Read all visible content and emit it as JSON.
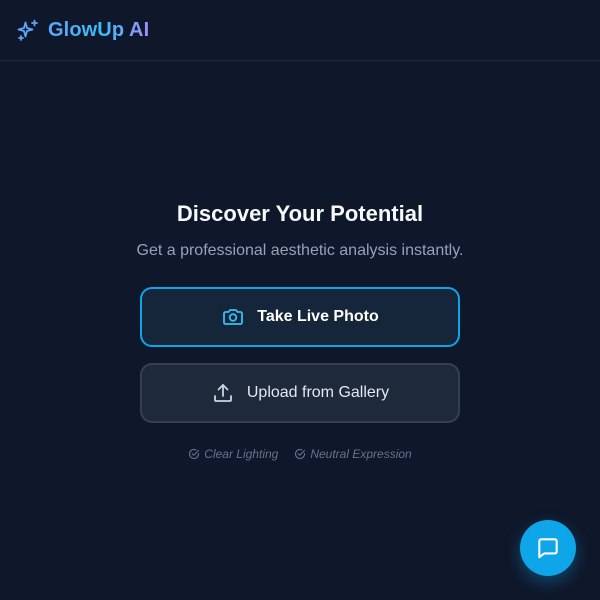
{
  "app": {
    "name": "GlowUp AI",
    "logo_icon": "sparkles-icon",
    "brand_gradient": [
      "#60a5fa",
      "#38bdf8",
      "#a78bfa"
    ]
  },
  "hero": {
    "title": "Discover Your Potential",
    "subtitle": "Get a professional aesthetic analysis instantly."
  },
  "actions": {
    "live_photo": {
      "label": "Take Live Photo",
      "icon": "camera-icon"
    },
    "upload": {
      "label": "Upload from Gallery",
      "icon": "upload-icon"
    }
  },
  "tips": [
    {
      "label": "Clear Lighting",
      "icon": "check-circle-icon"
    },
    {
      "label": "Neutral Expression",
      "icon": "check-circle-icon"
    }
  ],
  "chat": {
    "icon": "chat-bubble-icon"
  },
  "colors": {
    "background": "#0f172a",
    "accent": "#0ea5e9",
    "surface": "#1e293b"
  }
}
